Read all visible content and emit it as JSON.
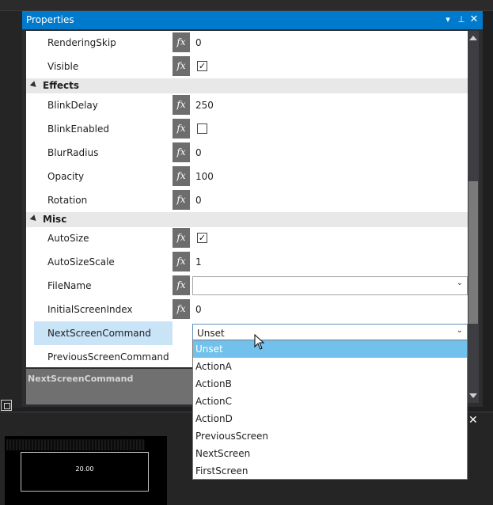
{
  "panel": {
    "title": "Properties",
    "controls": {
      "dropdown": "▾",
      "pin": "📌",
      "close": "✕"
    }
  },
  "rows": [
    {
      "name": "RenderingSkip",
      "fx": "fx",
      "value": "0"
    },
    {
      "name": "Visible",
      "fx": "fx",
      "checked": "✓"
    },
    {
      "category": "Effects"
    },
    {
      "name": "BlinkDelay",
      "fx": "fx",
      "value": "250"
    },
    {
      "name": "BlinkEnabled",
      "fx": "fx",
      "checked": ""
    },
    {
      "name": "BlurRadius",
      "fx": "fx",
      "value": "0"
    },
    {
      "name": "Opacity",
      "fx": "fx",
      "value": "100"
    },
    {
      "name": "Rotation",
      "fx": "fx",
      "value": "0"
    },
    {
      "category": "Misc"
    },
    {
      "name": "AutoSize",
      "fx": "fx",
      "checked": "✓"
    },
    {
      "name": "AutoSizeScale",
      "fx": "fx",
      "value": "1"
    },
    {
      "name": "FileName",
      "fx": "fx",
      "combo": ""
    },
    {
      "name": "InitialScreenIndex",
      "fx": "fx",
      "value": "0"
    },
    {
      "name": "NextScreenCommand",
      "combo": "Unset"
    },
    {
      "name": "PreviousScreenCommand"
    }
  ],
  "description": {
    "label": "NextScreenCommand"
  },
  "dropdown": {
    "selected": "Unset",
    "options": [
      "Unset",
      "ActionA",
      "ActionB",
      "ActionC",
      "ActionD",
      "PreviousScreen",
      "NextScreen",
      "FirstScreen"
    ]
  },
  "combo_arrow": "⌄",
  "preview": {
    "value": "20.00"
  },
  "bottom_close": "✕"
}
